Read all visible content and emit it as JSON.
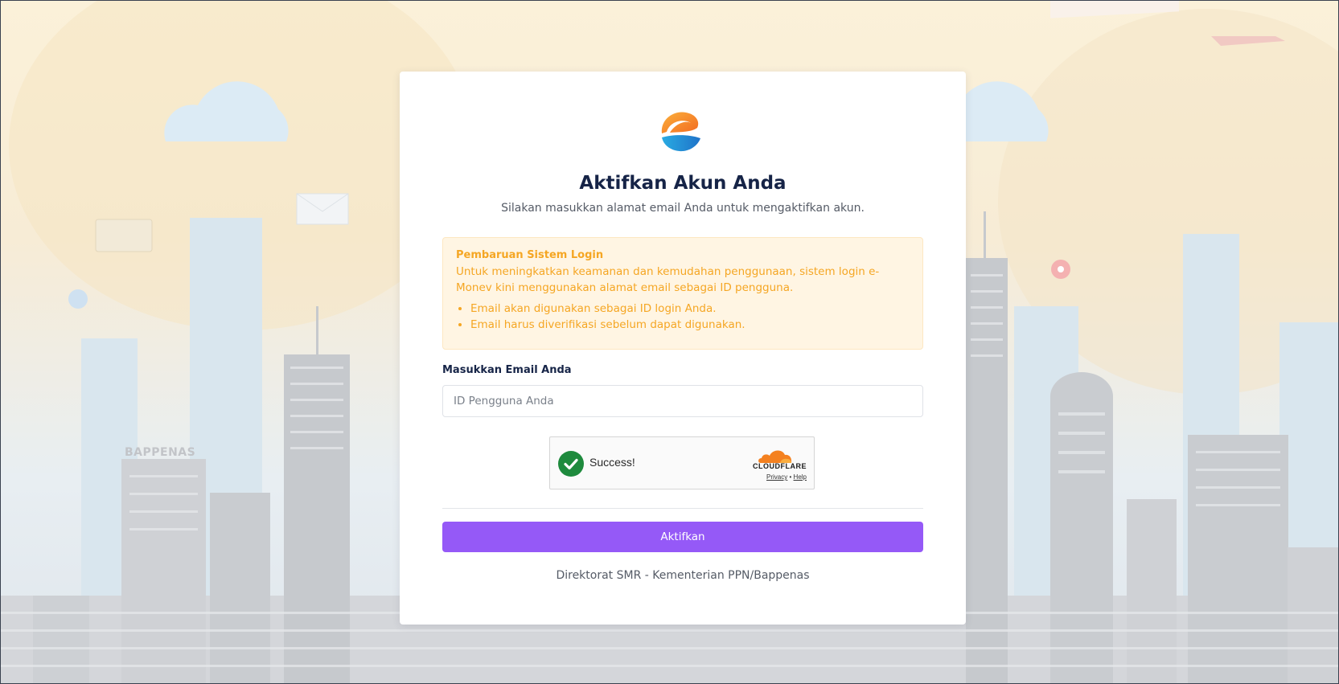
{
  "background": {
    "watermark": "BAPPENAS"
  },
  "card": {
    "title": "Aktifkan Akun Anda",
    "subtitle": "Silakan masukkan alamat email Anda untuk mengaktifkan akun."
  },
  "alert": {
    "title": "Pembaruan Sistem Login",
    "body": "Untuk meningkatkan keamanan dan kemudahan penggunaan, sistem login e-Monev kini menggunakan alamat email sebagai ID pengguna.",
    "items": [
      "Email akan digunakan sebagai ID login Anda.",
      "Email harus diverifikasi sebelum dapat digunakan."
    ]
  },
  "form": {
    "email_label": "Masukkan Email Anda",
    "email_placeholder": "ID Pengguna Anda",
    "email_value": "",
    "submit_label": "Aktifkan"
  },
  "captcha": {
    "status": "Success!",
    "brand": "CLOUDFLARE",
    "privacy_label": "Privacy",
    "separator": "•",
    "help_label": "Help"
  },
  "footer": {
    "text": "Direktorat SMR - Kementerian PPN/Bappenas"
  },
  "colors": {
    "primary": "#9559f7",
    "alert_text": "#f5a623",
    "alert_bg": "#fff5e3",
    "title": "#162447",
    "success": "#1e8a3d",
    "cloudflare_orange": "#f48120"
  },
  "icons": {
    "logo": "emonev-logo",
    "captcha_check": "check-circle-icon",
    "captcha_brand": "cloudflare-cloud-icon"
  }
}
